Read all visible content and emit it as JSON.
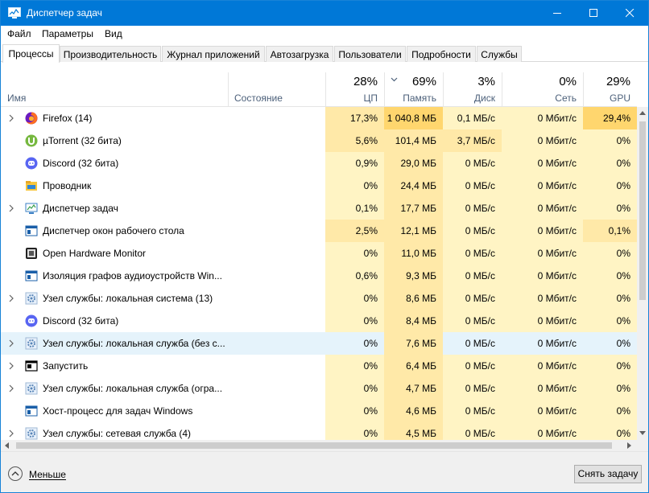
{
  "window": {
    "title": "Диспетчер задач",
    "accent": "#0078d7"
  },
  "menu": {
    "file": "Файл",
    "params": "Параметры",
    "view": "Вид"
  },
  "tabs": [
    {
      "label": "Процессы",
      "active": true
    },
    {
      "label": "Производительность"
    },
    {
      "label": "Журнал приложений"
    },
    {
      "label": "Автозагрузка"
    },
    {
      "label": "Пользователи"
    },
    {
      "label": "Подробности"
    },
    {
      "label": "Службы"
    }
  ],
  "columns": {
    "name": "Имя",
    "state": "Состояние",
    "cpu": {
      "pct": "28%",
      "label": "ЦП"
    },
    "mem": {
      "pct": "69%",
      "label": "Память"
    },
    "disk": {
      "pct": "3%",
      "label": "Диск"
    },
    "net": {
      "pct": "0%",
      "label": "Сеть"
    },
    "gpu": {
      "pct": "29%",
      "label": "GPU"
    }
  },
  "rows": [
    {
      "name": "Firefox (14)",
      "icon": "firefox-icon",
      "expand": true,
      "cpu": "17,3%",
      "mem": "1 040,8 МБ",
      "disk": "0,1 МБ/с",
      "net": "0 Мбит/с",
      "gpu": "29,4%"
    },
    {
      "name": "µTorrent (32 бита)",
      "icon": "utorrent-icon",
      "expand": false,
      "cpu": "5,6%",
      "mem": "101,4 МБ",
      "disk": "3,7 МБ/с",
      "net": "0 Мбит/с",
      "gpu": "0%"
    },
    {
      "name": "Discord (32 бита)",
      "icon": "discord-icon",
      "expand": false,
      "cpu": "0,9%",
      "mem": "29,0 МБ",
      "disk": "0 МБ/с",
      "net": "0 Мбит/с",
      "gpu": "0%"
    },
    {
      "name": "Проводник",
      "icon": "explorer-icon",
      "expand": false,
      "cpu": "0%",
      "mem": "24,4 МБ",
      "disk": "0 МБ/с",
      "net": "0 Мбит/с",
      "gpu": "0%"
    },
    {
      "name": "Диспетчер задач",
      "icon": "task-manager-icon",
      "expand": true,
      "cpu": "0,1%",
      "mem": "17,7 МБ",
      "disk": "0 МБ/с",
      "net": "0 Мбит/с",
      "gpu": "0%"
    },
    {
      "name": "Диспетчер окон рабочего стола",
      "icon": "dwm-icon",
      "expand": false,
      "cpu": "2,5%",
      "mem": "12,1 МБ",
      "disk": "0 МБ/с",
      "net": "0 Мбит/с",
      "gpu": "0,1%"
    },
    {
      "name": "Open Hardware Monitor",
      "icon": "hardware-monitor-icon",
      "expand": false,
      "cpu": "0%",
      "mem": "11,0 МБ",
      "disk": "0 МБ/с",
      "net": "0 Мбит/с",
      "gpu": "0%"
    },
    {
      "name": "Изоляция графов аудиоустройств Win...",
      "icon": "audio-graph-icon",
      "expand": false,
      "cpu": "0,6%",
      "mem": "9,3 МБ",
      "disk": "0 МБ/с",
      "net": "0 Мбит/с",
      "gpu": "0%"
    },
    {
      "name": "Узел службы: локальная система (13)",
      "icon": "service-gear-icon",
      "expand": true,
      "cpu": "0%",
      "mem": "8,6 МБ",
      "disk": "0 МБ/с",
      "net": "0 Мбит/с",
      "gpu": "0%"
    },
    {
      "name": "Discord (32 бита)",
      "icon": "discord-icon",
      "expand": false,
      "cpu": "0%",
      "mem": "8,4 МБ",
      "disk": "0 МБ/с",
      "net": "0 Мбит/с",
      "gpu": "0%"
    },
    {
      "name": "Узел службы: локальная служба (без с...",
      "icon": "service-gear-icon",
      "expand": true,
      "hover": true,
      "cpu": "0%",
      "mem": "7,6 МБ",
      "disk": "0 МБ/с",
      "net": "0 Мбит/с",
      "gpu": "0%"
    },
    {
      "name": "Запустить",
      "icon": "run-icon",
      "expand": true,
      "cpu": "0%",
      "mem": "6,4 МБ",
      "disk": "0 МБ/с",
      "net": "0 Мбит/с",
      "gpu": "0%"
    },
    {
      "name": "Узел службы: локальная служба (огра...",
      "icon": "service-gear-icon",
      "expand": true,
      "cpu": "0%",
      "mem": "4,7 МБ",
      "disk": "0 МБ/с",
      "net": "0 Мбит/с",
      "gpu": "0%"
    },
    {
      "name": "Хост-процесс для задач Windows",
      "icon": "host-process-icon",
      "expand": false,
      "cpu": "0%",
      "mem": "4,6 МБ",
      "disk": "0 МБ/с",
      "net": "0 Мбит/с",
      "gpu": "0%"
    },
    {
      "name": "Узел службы: сетевая служба (4)",
      "icon": "service-gear-icon",
      "expand": true,
      "cpu": "0%",
      "mem": "4,5 МБ",
      "disk": "0 МБ/с",
      "net": "0 Мбит/с",
      "gpu": "0%"
    }
  ],
  "footer": {
    "less": "Меньше",
    "end_task": "Снять задачу"
  }
}
